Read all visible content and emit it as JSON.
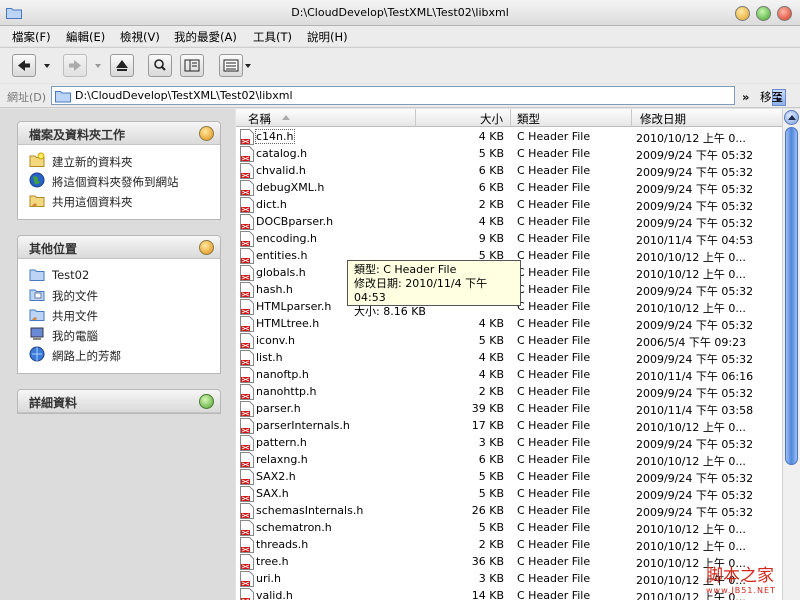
{
  "window": {
    "title": "D:\\CloudDevelop\\TestXML\\Test02\\libxml"
  },
  "menu": [
    "檔案(F)",
    "編輯(E)",
    "檢視(V)",
    "我的最愛(A)",
    "工具(T)",
    "說明(H)"
  ],
  "address": {
    "label": "網址(D)",
    "path": "D:\\CloudDevelop\\TestXML\\Test02\\libxml",
    "go_label": "移至"
  },
  "tasks_panel": {
    "title": "檔案及資料夾工作",
    "items": [
      {
        "label": "建立新的資料夾",
        "icon": "new-folder-icon"
      },
      {
        "label": "將這個資料夾發佈到網站",
        "icon": "publish-web-icon"
      },
      {
        "label": "共用這個資料夾",
        "icon": "share-folder-icon"
      }
    ]
  },
  "places_panel": {
    "title": "其他位置",
    "items": [
      {
        "label": "Test02",
        "icon": "folder-icon"
      },
      {
        "label": "我的文件",
        "icon": "my-documents-icon"
      },
      {
        "label": "共用文件",
        "icon": "shared-documents-icon"
      },
      {
        "label": "我的電腦",
        "icon": "my-computer-icon"
      },
      {
        "label": "網路上的芳鄰",
        "icon": "network-places-icon"
      }
    ]
  },
  "details_panel": {
    "title": "詳細資料"
  },
  "columns": {
    "name": "名稱",
    "size": "大小",
    "type": "類型",
    "modified": "修改日期"
  },
  "files": [
    {
      "name": "c14n.h",
      "size": "4 KB",
      "type": "C Header File",
      "date": "2010/10/12 上午 0..."
    },
    {
      "name": "catalog.h",
      "size": "5 KB",
      "type": "C Header File",
      "date": "2009/9/24 下午 05:32"
    },
    {
      "name": "chvalid.h",
      "size": "6 KB",
      "type": "C Header File",
      "date": "2009/9/24 下午 05:32"
    },
    {
      "name": "debugXML.h",
      "size": "6 KB",
      "type": "C Header File",
      "date": "2009/9/24 下午 05:32"
    },
    {
      "name": "dict.h",
      "size": "2 KB",
      "type": "C Header File",
      "date": "2009/9/24 下午 05:32"
    },
    {
      "name": "DOCBparser.h",
      "size": "4 KB",
      "type": "C Header File",
      "date": "2009/9/24 下午 05:32"
    },
    {
      "name": "encoding.h",
      "size": "9 KB",
      "type": "C Header File",
      "date": "2010/11/4 下午 04:53"
    },
    {
      "name": "entities.h",
      "size": "5 KB",
      "type": "C Header File",
      "date": "2010/10/12 上午 0..."
    },
    {
      "name": "globals.h",
      "size": "",
      "type": "C Header File",
      "date": "2010/10/12 上午 0..."
    },
    {
      "name": "hash.h",
      "size": "",
      "type": "C Header File",
      "date": "2009/9/24 下午 05:32"
    },
    {
      "name": "HTMLparser.h",
      "size": "",
      "type": "C Header File",
      "date": "2010/10/12 上午 0..."
    },
    {
      "name": "HTMLtree.h",
      "size": "4 KB",
      "type": "C Header File",
      "date": "2009/9/24 下午 05:32"
    },
    {
      "name": "iconv.h",
      "size": "5 KB",
      "type": "C Header File",
      "date": "2006/5/4 下午 09:23"
    },
    {
      "name": "list.h",
      "size": "4 KB",
      "type": "C Header File",
      "date": "2009/9/24 下午 05:32"
    },
    {
      "name": "nanoftp.h",
      "size": "4 KB",
      "type": "C Header File",
      "date": "2010/11/4 下午 06:16"
    },
    {
      "name": "nanohttp.h",
      "size": "2 KB",
      "type": "C Header File",
      "date": "2009/9/24 下午 05:32"
    },
    {
      "name": "parser.h",
      "size": "39 KB",
      "type": "C Header File",
      "date": "2010/11/4 下午 03:58"
    },
    {
      "name": "parserInternals.h",
      "size": "17 KB",
      "type": "C Header File",
      "date": "2010/10/12 上午 0..."
    },
    {
      "name": "pattern.h",
      "size": "3 KB",
      "type": "C Header File",
      "date": "2009/9/24 下午 05:32"
    },
    {
      "name": "relaxng.h",
      "size": "6 KB",
      "type": "C Header File",
      "date": "2010/10/12 上午 0..."
    },
    {
      "name": "SAX2.h",
      "size": "5 KB",
      "type": "C Header File",
      "date": "2009/9/24 下午 05:32"
    },
    {
      "name": "SAX.h",
      "size": "5 KB",
      "type": "C Header File",
      "date": "2009/9/24 下午 05:32"
    },
    {
      "name": "schemasInternals.h",
      "size": "26 KB",
      "type": "C Header File",
      "date": "2009/9/24 下午 05:32"
    },
    {
      "name": "schematron.h",
      "size": "5 KB",
      "type": "C Header File",
      "date": "2010/10/12 上午 0..."
    },
    {
      "name": "threads.h",
      "size": "2 KB",
      "type": "C Header File",
      "date": "2010/10/12 上午 0..."
    },
    {
      "name": "tree.h",
      "size": "36 KB",
      "type": "C Header File",
      "date": "2010/10/12 上午 0..."
    },
    {
      "name": "uri.h",
      "size": "3 KB",
      "type": "C Header File",
      "date": "2010/10/12 上午 0..."
    },
    {
      "name": "valid.h",
      "size": "14 KB",
      "type": "C Header File",
      "date": "2010/10/12 上午 0..."
    }
  ],
  "tooltip": {
    "type_line": "類型: C Header File",
    "date_line": "修改日期: 2010/11/4 下午 04:53",
    "size_line": "大小: 8.16 KB"
  },
  "watermark": {
    "text": "脚本之家",
    "sub": "www.JB51.NET"
  },
  "colors": {
    "addr_border": "#7f9db9",
    "tooltip_bg": "#ffffe1",
    "scroll_thumb": "#4f86dc",
    "watermark": "#d0281b"
  }
}
